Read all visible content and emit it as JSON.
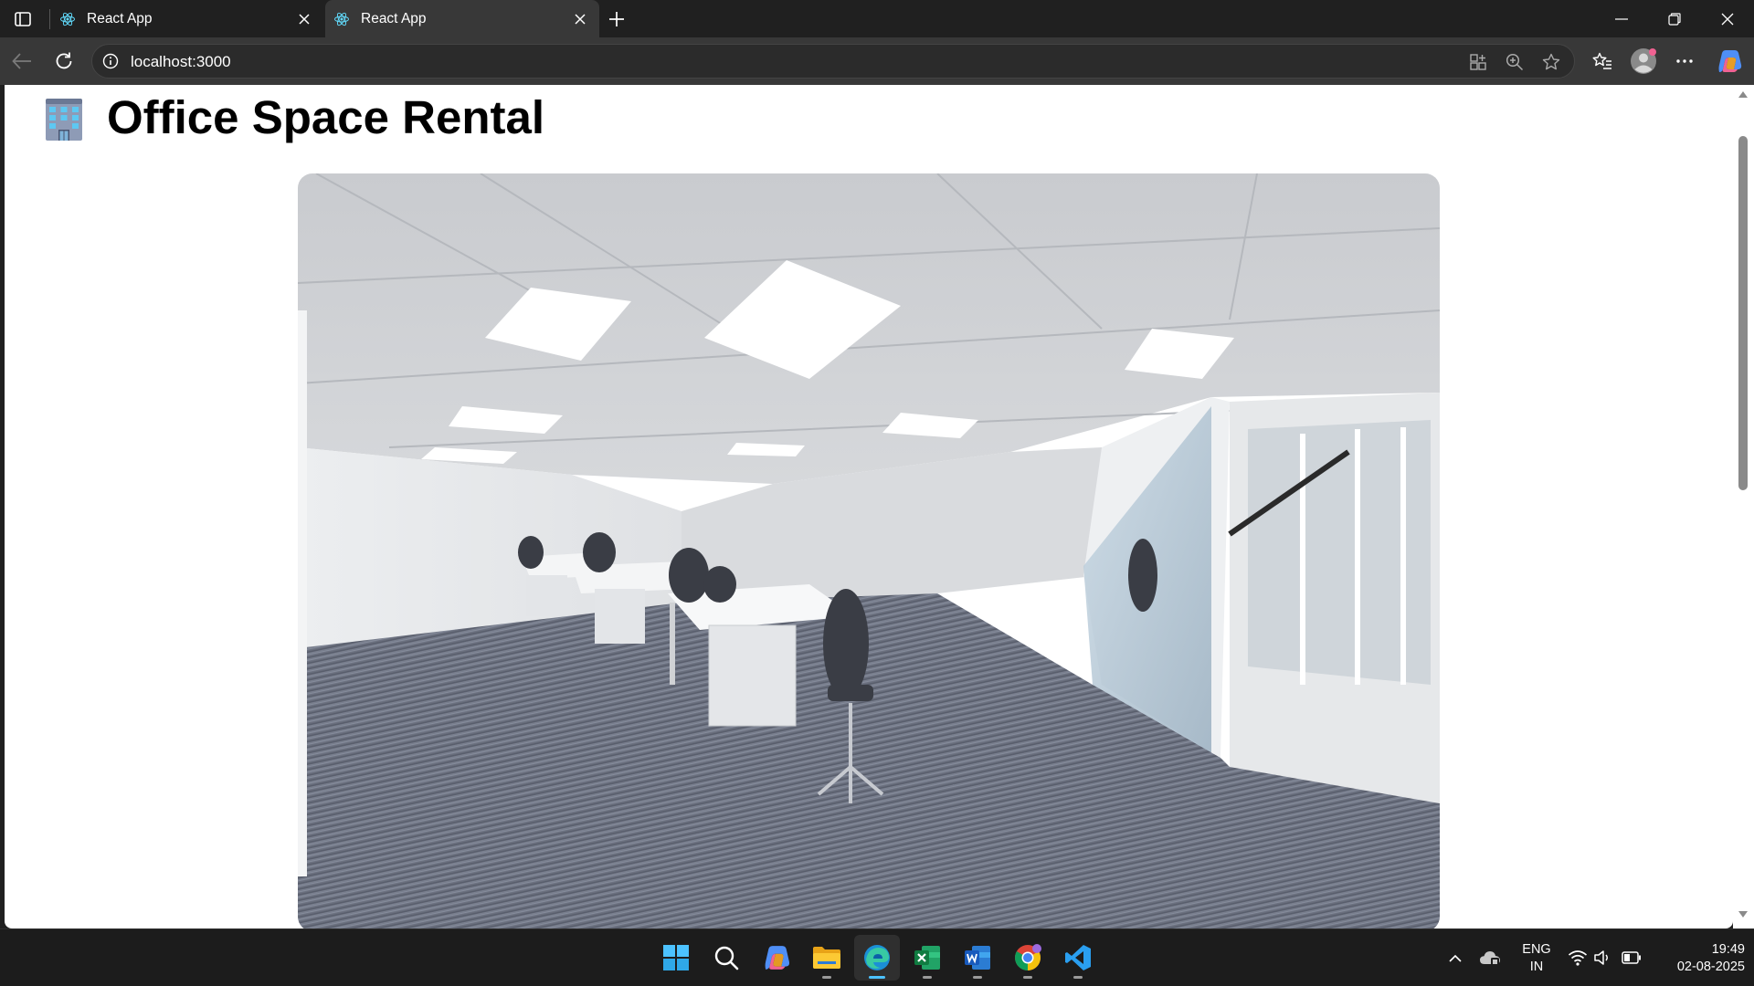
{
  "browser": {
    "tabs": [
      {
        "title": "React App",
        "active": false
      },
      {
        "title": "React App",
        "active": true
      }
    ],
    "address": "localhost:3000"
  },
  "page": {
    "title": "Office Space Rental",
    "header_icon": "office-building-emoji",
    "image": "office-interior-photo"
  },
  "taskbar": {
    "apps": [
      "windows-start",
      "search",
      "copilot",
      "file-explorer",
      "edge",
      "excel",
      "word",
      "chrome",
      "vscode"
    ],
    "language": "ENG",
    "region": "IN",
    "time": "19:49",
    "date": "02-08-2025"
  },
  "colors": {
    "tabstrip": "#202020",
    "toolbar": "#383838",
    "page_bg": "#ffffff",
    "taskbar": "#1c1c1c",
    "accent": "#4cc2ff"
  }
}
